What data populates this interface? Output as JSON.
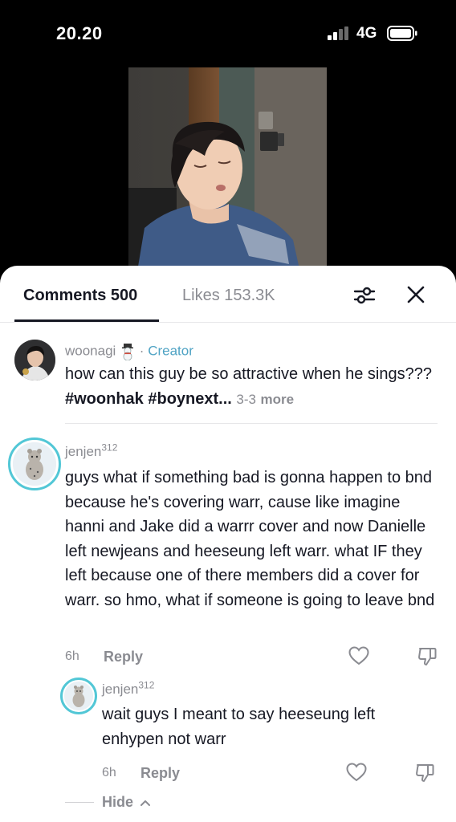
{
  "status_bar": {
    "time": "20.20",
    "network": "4G"
  },
  "tabs": {
    "comments": "Comments 500",
    "likes": "Likes 153.3K"
  },
  "comments": [
    {
      "username": "woonagi",
      "separator": "·",
      "badge": "Creator",
      "text_plain": "how can this guy be so attractive when he sings??? ",
      "hashtag_1": "#woonhak",
      "hashtag_2": "#boynext",
      "ellipsis": "...",
      "date": "3-3",
      "more": "more"
    },
    {
      "username": "jenjen",
      "username_sup": "312",
      "text": "guys what if something bad is gonna happen to bnd because he's covering warr, cause like imagine hanni and Jake did a warrr cover and now Danielle left newjeans and heeseung left warr. what IF they left because one of there members did a cover for warr. so hmo, what if someone is going to leave bnd",
      "time": "6h",
      "reply": "Reply",
      "replies": [
        {
          "username": "jenjen",
          "username_sup": "312",
          "text": "wait guys I meant to say heeseung left enhypen not warr",
          "time": "6h",
          "reply": "Reply"
        }
      ],
      "hide": "Hide"
    }
  ],
  "colors": {
    "accent_creator": "#4fa3c4",
    "avatar_ring": "#52c7d6",
    "text_primary": "#161823",
    "text_secondary": "#8a8b91"
  }
}
